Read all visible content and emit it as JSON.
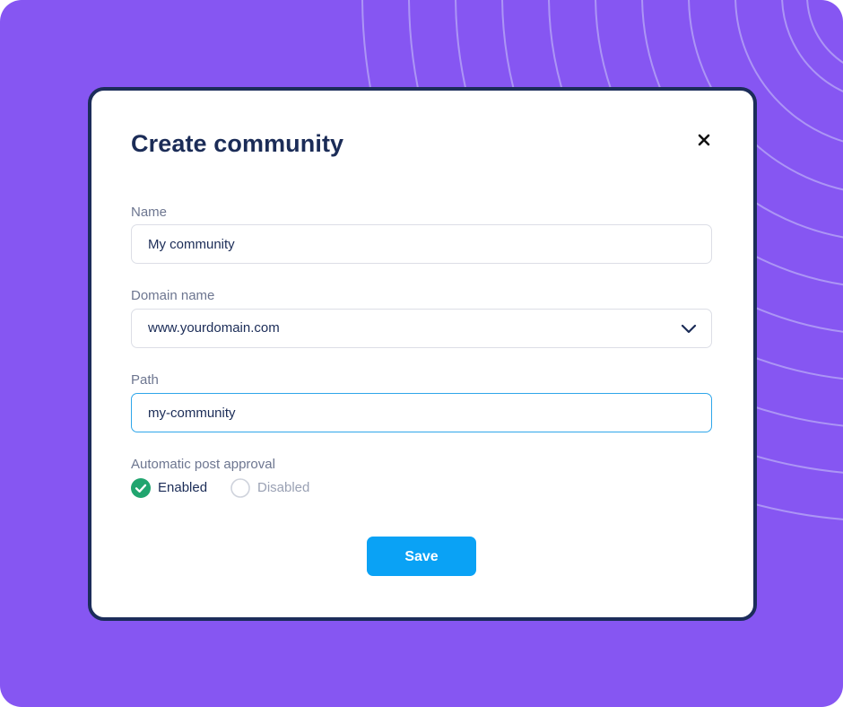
{
  "dialog": {
    "title": "Create community",
    "close_icon": "close-icon"
  },
  "form": {
    "name": {
      "label": "Name",
      "value": "My community"
    },
    "domain": {
      "label": "Domain name",
      "value": "www.yourdomain.com",
      "icon": "chevron-down-icon"
    },
    "path": {
      "label": "Path",
      "value": "my-community"
    },
    "approval": {
      "label": "Automatic post approval",
      "options": [
        {
          "label": "Enabled",
          "selected": true
        },
        {
          "label": "Disabled",
          "selected": false
        }
      ]
    },
    "save_label": "Save"
  },
  "colors": {
    "background": "#8656f2",
    "dialog_border": "#1c2d5a",
    "title_text": "#1b2c57",
    "label_text": "#6d7690",
    "focus_border": "#2fa6ea",
    "radio_selected": "#21a56f",
    "save_button": "#0aa2f5"
  }
}
